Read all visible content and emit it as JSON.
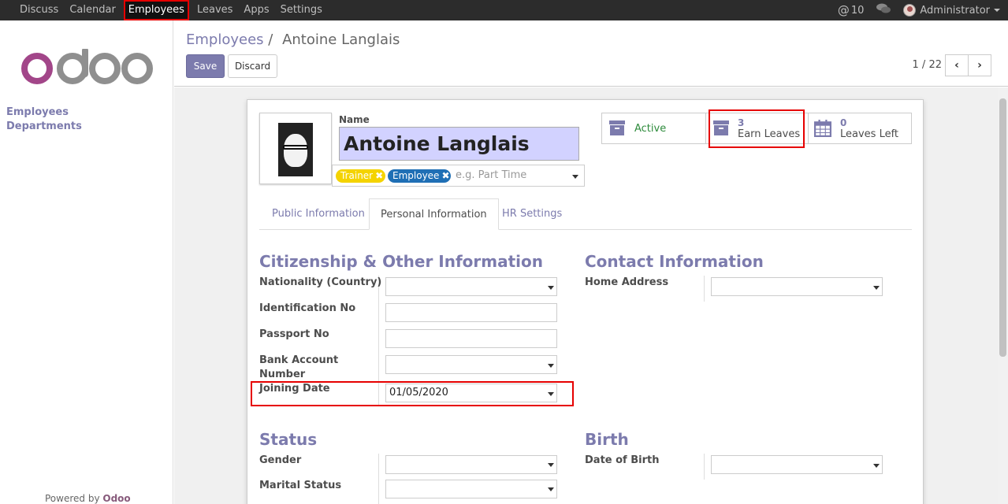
{
  "topbar": {
    "menu": [
      "Discuss",
      "Calendar",
      "Employees",
      "Leaves",
      "Apps",
      "Settings"
    ],
    "messages_count": "10",
    "user": "Administrator"
  },
  "sidebar": {
    "items": [
      "Employees",
      "Departments"
    ],
    "powered_prefix": "Powered by",
    "powered_brand": "Odoo"
  },
  "breadcrumb": {
    "parent": "Employees",
    "separator": "/",
    "current": "Antoine Langlais"
  },
  "buttons": {
    "save": "Save",
    "discard": "Discard"
  },
  "pager": {
    "text": "1 / 22",
    "prev": "‹",
    "next": "›"
  },
  "employee": {
    "name_label": "Name",
    "name": "Antoine Langlais",
    "tags": [
      "Trainer",
      "Employee"
    ],
    "tags_placeholder": "e.g. Part Time"
  },
  "smart_buttons": {
    "active": "Active",
    "earn_leaves_count": "3",
    "earn_leaves_label": "Earn Leaves",
    "leaves_left_count": "0",
    "leaves_left_label": "Leaves Left"
  },
  "tabs": [
    "Public Information",
    "Personal Information",
    "HR Settings"
  ],
  "citizenship": {
    "title": "Citizenship & Other Information",
    "nationality_label": "Nationality (Country)",
    "identification_label": "Identification No",
    "passport_label": "Passport No",
    "bank_label_line1": "Bank Account",
    "bank_label_line2": "Number",
    "joining_label": "Joining Date",
    "joining_value": "01/05/2020"
  },
  "contact": {
    "title": "Contact Information",
    "home_address_label": "Home Address"
  },
  "status": {
    "title": "Status",
    "gender_label": "Gender",
    "marital_label": "Marital Status"
  },
  "birth": {
    "title": "Birth",
    "dob_label": "Date of Birth"
  },
  "colors": {
    "brand": "#7c7bad",
    "odoo_purple": "#875a7b",
    "highlight": "#e60000",
    "name_field_bg": "#d2d2ff"
  }
}
